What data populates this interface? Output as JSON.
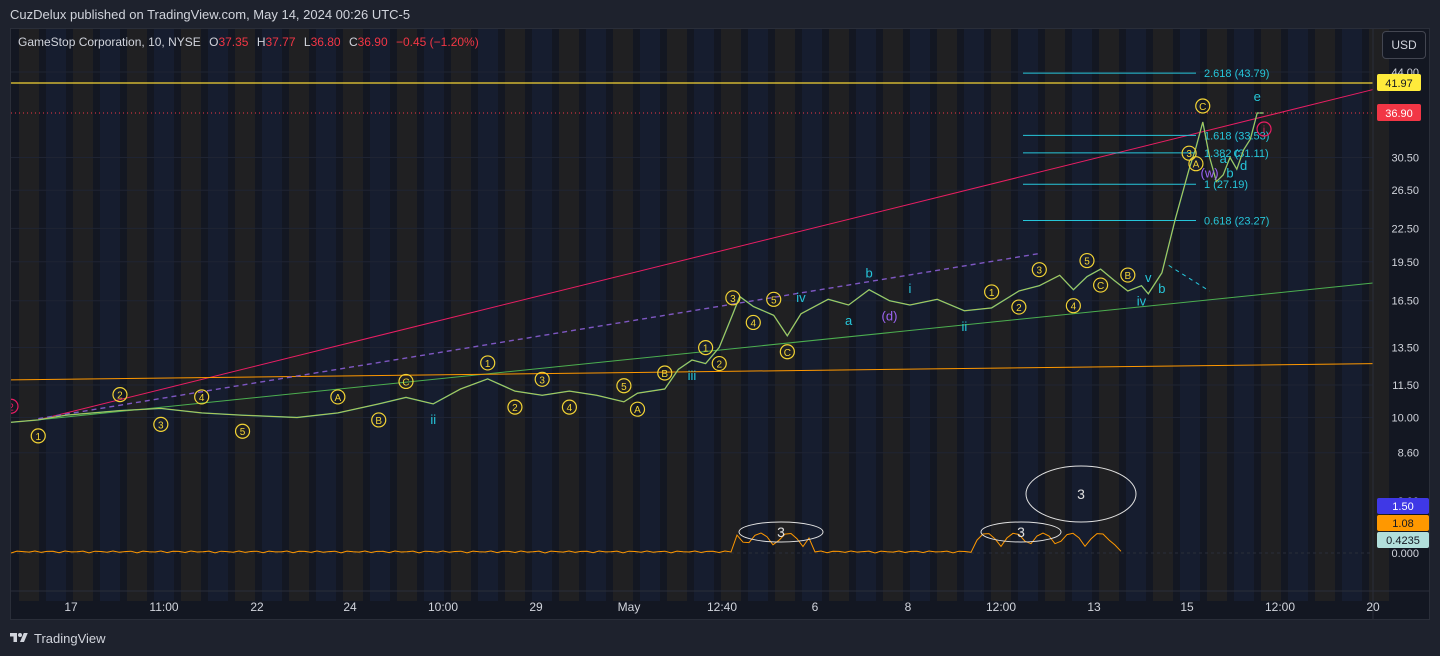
{
  "header": {
    "published_by": "CuzDelux published on TradingView.com, May 14, 2024 00:26 UTC-5"
  },
  "legend": {
    "symbol": "GameStop Corporation, 10, NYSE",
    "open_label": "O",
    "open": "37.35",
    "high_label": "H",
    "high": "37.77",
    "low_label": "L",
    "low": "36.80",
    "close_label": "C",
    "close": "36.90",
    "change": "−0.45 (−1.20%)"
  },
  "currency_button": "USD",
  "footer": {
    "brand": "TradingView"
  },
  "colors": {
    "background": "#131722",
    "up": "#26a69a",
    "down": "#ef5350",
    "yellow": "#f2d335",
    "cyan": "#26c6da",
    "pink": "#e91e63",
    "green_line": "#4caf50",
    "orange_line": "#ff9800",
    "purple_dashed": "#7e57c2",
    "price_label_yellow": "#ffeb3b",
    "price_label_red": "#f23645"
  },
  "chart_data": {
    "type": "line",
    "price_axis": {
      "scale": "log",
      "ticks": [
        "44.00",
        "30.50",
        "26.50",
        "22.50",
        "19.50",
        "16.50",
        "13.50",
        "11.50",
        "10.00",
        "8.60"
      ],
      "tick_values": [
        44.0,
        30.5,
        26.5,
        22.5,
        19.5,
        16.5,
        13.5,
        11.5,
        10.0,
        8.6
      ],
      "ylim": [
        8.3,
        52.0
      ],
      "labels": [
        {
          "text": "41.97",
          "value": 41.97,
          "style": "yellow"
        },
        {
          "text": "36.90",
          "value": 36.9,
          "style": "red"
        }
      ]
    },
    "time_axis": {
      "ticks": [
        "17",
        "11:00",
        "22",
        "24",
        "10:00",
        "29",
        "May",
        "12:40",
        "6",
        "8",
        "12:00",
        "13",
        "15",
        "12:00",
        "20"
      ]
    },
    "price_path": [
      [
        0,
        9.8
      ],
      [
        0.02,
        9.9
      ],
      [
        0.04,
        10.1
      ],
      [
        0.08,
        10.3
      ],
      [
        0.11,
        10.4
      ],
      [
        0.14,
        10.2
      ],
      [
        0.17,
        10.1
      ],
      [
        0.21,
        10.0
      ],
      [
        0.24,
        10.2
      ],
      [
        0.27,
        10.6
      ],
      [
        0.29,
        10.9
      ],
      [
        0.31,
        10.6
      ],
      [
        0.33,
        11.3
      ],
      [
        0.35,
        11.8
      ],
      [
        0.37,
        11.2
      ],
      [
        0.39,
        11.0
      ],
      [
        0.41,
        11.2
      ],
      [
        0.43,
        11.0
      ],
      [
        0.45,
        10.7
      ],
      [
        0.46,
        11.1
      ],
      [
        0.48,
        11.3
      ],
      [
        0.49,
        12.3
      ],
      [
        0.5,
        12.8
      ],
      [
        0.51,
        12.6
      ],
      [
        0.52,
        13.5
      ],
      [
        0.53,
        15.6
      ],
      [
        0.535,
        16.8
      ],
      [
        0.545,
        16.1
      ],
      [
        0.56,
        15.5
      ],
      [
        0.57,
        14.2
      ],
      [
        0.58,
        15.6
      ],
      [
        0.6,
        16.6
      ],
      [
        0.615,
        16.2
      ],
      [
        0.63,
        17.3
      ],
      [
        0.645,
        16.5
      ],
      [
        0.66,
        16.2
      ],
      [
        0.68,
        16.6
      ],
      [
        0.7,
        15.8
      ],
      [
        0.72,
        16.0
      ],
      [
        0.74,
        17.2
      ],
      [
        0.755,
        17.6
      ],
      [
        0.77,
        18.4
      ],
      [
        0.78,
        17.3
      ],
      [
        0.79,
        18.3
      ],
      [
        0.8,
        18.9
      ],
      [
        0.81,
        18.0
      ],
      [
        0.82,
        17.2
      ],
      [
        0.83,
        17.6
      ],
      [
        0.835,
        17.0
      ],
      [
        0.845,
        18.6
      ],
      [
        0.855,
        23.5
      ],
      [
        0.865,
        29.0
      ],
      [
        0.87,
        31.8
      ],
      [
        0.875,
        35.5
      ],
      [
        0.88,
        30.5
      ],
      [
        0.885,
        27.5
      ],
      [
        0.89,
        28.3
      ],
      [
        0.895,
        30.5
      ],
      [
        0.9,
        29.0
      ],
      [
        0.905,
        31.5
      ],
      [
        0.91,
        33.0
      ],
      [
        0.915,
        36.9
      ],
      [
        0.92,
        36.9
      ]
    ],
    "overlay_lines": [
      {
        "name": "",
        "color": "pink",
        "from": [
          0.02,
          9.9
        ],
        "to": [
          1.0,
          40.8
        ]
      },
      {
        "name": "",
        "color": "green",
        "from": [
          0.02,
          9.9
        ],
        "to": [
          1.0,
          17.8
        ]
      },
      {
        "name": "",
        "color": "orange",
        "from": [
          0.0,
          11.75
        ],
        "to": [
          1.0,
          12.6
        ]
      },
      {
        "name": "",
        "color": "yellow",
        "from": [
          0.0,
          41.97
        ],
        "to": [
          1.0,
          41.97
        ]
      }
    ],
    "fibonacci_levels": [
      {
        "label": "2.618 (43.79)",
        "value": 43.79
      },
      {
        "label": "1.618 (33.53)",
        "value": 33.53
      },
      {
        "label": "1.382 (31.11)",
        "value": 31.11
      },
      {
        "label": "1 (27.19)",
        "value": 27.19
      },
      {
        "label": "0.618 (23.27)",
        "value": 23.27
      }
    ],
    "wave_labels": [
      {
        "text": "2",
        "style": "pink-circle"
      },
      {
        "text": "1",
        "style": "yellow-circle"
      },
      {
        "text": "2",
        "style": "yellow-circle"
      },
      {
        "text": "3",
        "style": "yellow-circle"
      },
      {
        "text": "4",
        "style": "yellow-circle"
      },
      {
        "text": "5",
        "style": "yellow-circle"
      },
      {
        "text": "A",
        "style": "yellow-circle"
      },
      {
        "text": "B",
        "style": "yellow-circle"
      },
      {
        "text": "C",
        "style": "yellow-circle"
      },
      {
        "text": "ii",
        "style": "cyan"
      },
      {
        "text": "1",
        "style": "yellow-circle"
      },
      {
        "text": "2",
        "style": "yellow-circle"
      },
      {
        "text": "3",
        "style": "yellow-circle"
      },
      {
        "text": "4",
        "style": "yellow-circle"
      },
      {
        "text": "5",
        "style": "yellow-circle"
      },
      {
        "text": "A",
        "style": "yellow-circle"
      },
      {
        "text": "B",
        "style": "yellow-circle"
      },
      {
        "text": "iii",
        "style": "cyan"
      },
      {
        "text": "1",
        "style": "yellow-circle"
      },
      {
        "text": "2",
        "style": "yellow-circle"
      },
      {
        "text": "3",
        "style": "yellow-circle"
      },
      {
        "text": "4",
        "style": "yellow-circle"
      },
      {
        "text": "5",
        "style": "yellow-circle"
      },
      {
        "text": "C",
        "style": "yellow-circle"
      },
      {
        "text": "iv",
        "style": "cyan"
      },
      {
        "text": "a",
        "style": "cyan"
      },
      {
        "text": "b",
        "style": "cyan"
      },
      {
        "text": "(d)",
        "style": "purple"
      },
      {
        "text": "i",
        "style": "cyan"
      },
      {
        "text": "ii",
        "style": "cyan"
      },
      {
        "text": "1",
        "style": "yellow-circle"
      },
      {
        "text": "2",
        "style": "yellow-circle"
      },
      {
        "text": "3",
        "style": "yellow-circle"
      },
      {
        "text": "4",
        "style": "yellow-circle"
      },
      {
        "text": "5",
        "style": "yellow-circle"
      },
      {
        "text": "C",
        "style": "yellow-circle"
      },
      {
        "text": "B",
        "style": "yellow-circle"
      },
      {
        "text": "iv",
        "style": "cyan"
      },
      {
        "text": "v",
        "style": "cyan"
      },
      {
        "text": "b",
        "style": "cyan"
      },
      {
        "text": "3",
        "style": "yellow-circle"
      },
      {
        "text": "A",
        "style": "yellow-circle"
      },
      {
        "text": "C",
        "style": "yellow-circle"
      },
      {
        "text": "(w)",
        "style": "purple"
      },
      {
        "text": "a",
        "style": "cyan"
      },
      {
        "text": "b",
        "style": "cyan"
      },
      {
        "text": "c",
        "style": "cyan"
      },
      {
        "text": "d",
        "style": "cyan"
      },
      {
        "text": "e",
        "style": "cyan"
      },
      {
        "text": "i",
        "style": "pink-circle"
      }
    ],
    "indicator": {
      "ticks": [
        "2.00",
        "0.000"
      ],
      "labels": [
        {
          "text": "1.50",
          "style": "blue"
        },
        {
          "text": "1.08",
          "style": "orange"
        },
        {
          "text": "0.4235",
          "style": "teal"
        }
      ],
      "annotations": [
        "3",
        "3",
        "3"
      ]
    }
  }
}
